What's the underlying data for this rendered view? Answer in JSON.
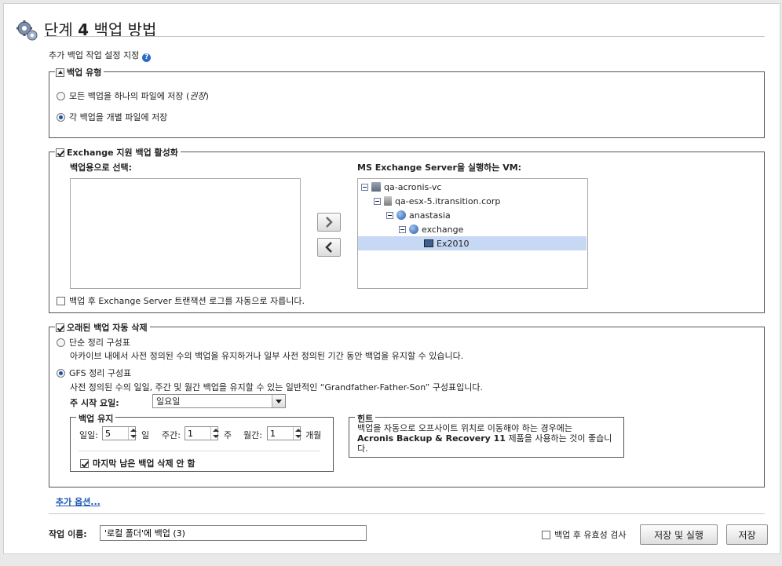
{
  "header": {
    "title_prefix": "단계 ",
    "step_number": "4",
    "title_suffix": " 백업 방법",
    "subtitle": "추가 백업 작업 설정 지정"
  },
  "backup_type": {
    "legend": "백업 유형",
    "options": [
      {
        "label": "모든 백업을 하나의 파일에 저장 (",
        "italic": "권장",
        "close": ")",
        "selected": false
      },
      {
        "label": "각 백업을 개별 파일에 저장",
        "selected": true
      }
    ]
  },
  "exchange": {
    "legend": "Exchange 지원 백업 활성화",
    "enabled": true,
    "left_label": "백업용으로 선택:",
    "right_label": "MS Exchange Server을 실행하는 VM:",
    "tree": [
      {
        "label": "qa-acronis-vc",
        "icon": "vcenter-icon",
        "level": 0,
        "selected": false
      },
      {
        "label": "qa-esx-5.itransition.corp",
        "icon": "host-icon",
        "level": 1,
        "selected": false
      },
      {
        "label": "anastasia",
        "icon": "resource-pool-icon",
        "level": 2,
        "selected": false
      },
      {
        "label": "exchange",
        "icon": "resource-pool-icon",
        "level": 3,
        "selected": false
      },
      {
        "label": "Ex2010",
        "icon": "vm-icon",
        "level": 4,
        "selected": true
      }
    ],
    "add_arrow": ">",
    "remove_arrow": "<",
    "truncate_label": "백업 후 Exchange Server 트랜잭션 로그를 자동으로 자릅니다.",
    "truncate_checked": false
  },
  "cleanup": {
    "legend": "오래된 백업 자동 삭제",
    "enabled": true,
    "simple": {
      "label": "단순 정리 구성표",
      "desc": "아카이브 내에서 사전 정의된 수의 백업을 유지하거나 일부 사전 정의된 기간 동안 백업을 유지할 수 있습니다.",
      "selected": false
    },
    "gfs": {
      "label": "GFS 정리 구성표",
      "desc": "사전 정의된 수의 일일, 주간 및 월간 백업을 유지할 수 있는 일반적인 “Grandfather-Father-Son” 구성표입니다.",
      "selected": true
    },
    "week_start_label": "주 시작 요일:",
    "week_start_value": "일요일",
    "retention": {
      "legend": "백업 유지",
      "daily_label": "일일:",
      "daily_value": "5",
      "daily_unit": "일",
      "weekly_label": "주간:",
      "weekly_value": "1",
      "weekly_unit": "주",
      "monthly_label": "월간:",
      "monthly_value": "1",
      "monthly_unit": "개월",
      "keep_last_label": "마지막 남은 백업 삭제 안 함",
      "keep_last_checked": true
    },
    "hint": {
      "legend": "힌트",
      "line1": "백업을 자동으로 오프사이트 위치로 이동해야 하는 경우에는",
      "product": "Acronis Backup & Recovery 11",
      "line2": " 제품을 사용하는 것이 좋습니",
      "line3": "다."
    }
  },
  "more_options": "추가 옵션...",
  "footer": {
    "task_name_label": "작업 이름:",
    "task_name_value": "'로컬 폴더'에 백업 (3)",
    "validate_label": "백업 후 유효성 검사",
    "validate_checked": false,
    "save_run_label": "저장 및 실행",
    "save_label": "저장"
  }
}
